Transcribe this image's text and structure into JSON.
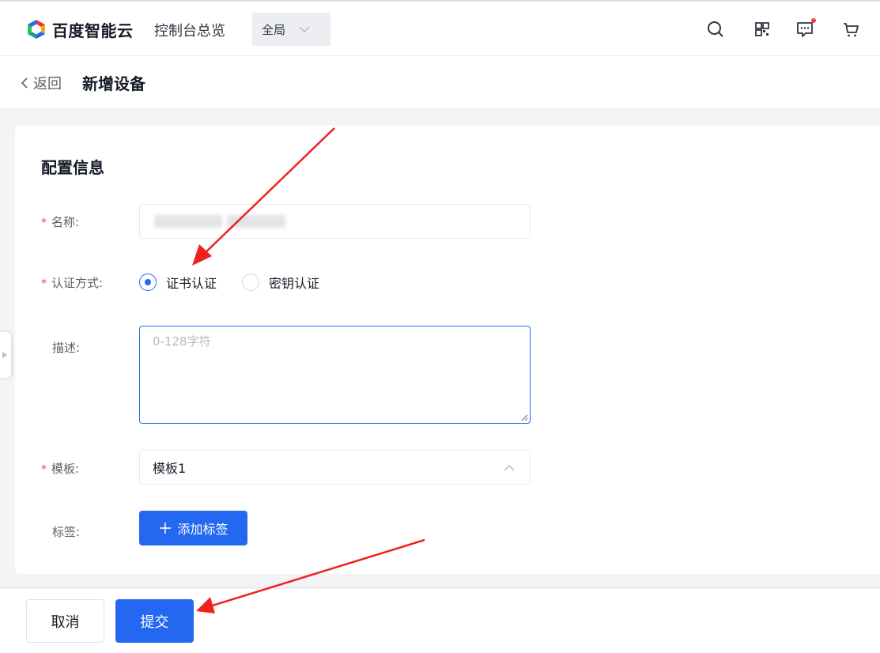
{
  "header": {
    "brand": "百度智能云",
    "console_link": "控制台总览",
    "scope_select": "全局",
    "icons": [
      "search-icon",
      "qrcode-icon",
      "message-icon",
      "cart-icon"
    ]
  },
  "subheader": {
    "back_label": "返回",
    "page_title": "新增设备"
  },
  "form": {
    "section_title": "配置信息",
    "name": {
      "label": "名称:",
      "required": true,
      "value": ""
    },
    "auth": {
      "label": "认证方式:",
      "required": true,
      "options": [
        {
          "label": "证书认证",
          "checked": true
        },
        {
          "label": "密钥认证",
          "checked": false
        }
      ]
    },
    "description": {
      "label": "描述:",
      "placeholder": "0-128字符"
    },
    "template": {
      "label": "模板:",
      "required": true,
      "value": "模板1"
    },
    "tags": {
      "label": "标签:",
      "add_button": "添加标签"
    }
  },
  "footer": {
    "cancel": "取消",
    "submit": "提交"
  },
  "colors": {
    "primary": "#2468f2",
    "required": "#f33e3e",
    "annotation_arrow": "#f02020"
  }
}
